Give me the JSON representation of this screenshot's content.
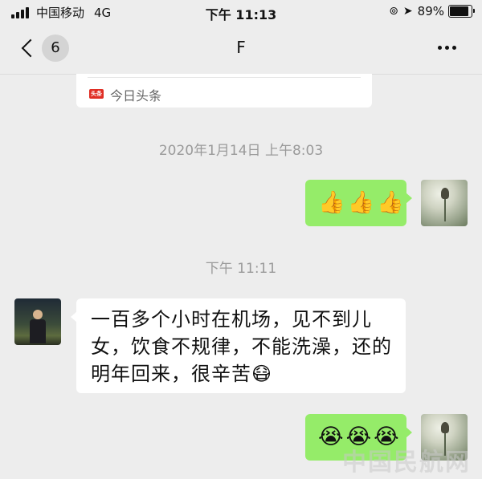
{
  "status_bar": {
    "carrier": "中国移动",
    "network": "4G",
    "time": "下午 11:13",
    "battery_percent": "89%",
    "battery_level": 0.89,
    "icons": [
      "signal-icon",
      "orientation-lock-icon",
      "location-icon",
      "battery-icon"
    ]
  },
  "nav": {
    "unread_count": "6",
    "title": "F",
    "icons": [
      "back-icon",
      "more-icon"
    ]
  },
  "article_card": {
    "source": "今日头条"
  },
  "messages": [
    {
      "type": "timestamp",
      "text": "2020年1月14日 上午8:03"
    },
    {
      "type": "sent",
      "emojis": [
        "👍",
        "👍",
        "👍"
      ]
    },
    {
      "type": "timestamp",
      "text": "下午 11:11"
    },
    {
      "type": "received",
      "lines": [
        "一百多个小时在机场，见不到儿",
        "女，饮食不规律，不能洗澡，还的",
        "明年回来，很辛苦"
      ],
      "emoji": "😷"
    },
    {
      "type": "sent",
      "emojis": [
        "😭",
        "😭",
        "😭"
      ]
    }
  ],
  "watermark": "中国民航网",
  "colors": {
    "background": "#ededed",
    "sent_bubble": "#95ec69",
    "received_bubble": "#ffffff",
    "timestamp_text": "#9a9a9a"
  }
}
